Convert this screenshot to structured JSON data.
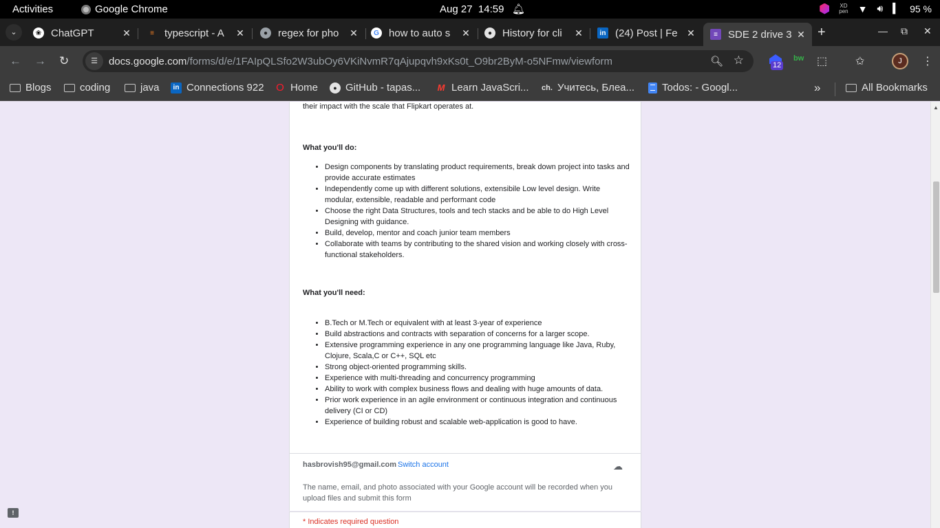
{
  "system_bar": {
    "activities": "Activities",
    "app_name": "Google Chrome",
    "date": "Aug 27",
    "time": "14:59",
    "battery": "95 %"
  },
  "tabs": [
    {
      "title": "ChatGPT",
      "icon": "chatgpt-icon"
    },
    {
      "title": "typescript - A",
      "icon": "stackoverflow-icon"
    },
    {
      "title": "regex for pho",
      "icon": "globe-icon"
    },
    {
      "title": "how to auto s",
      "icon": "google-icon"
    },
    {
      "title": "History for cli",
      "icon": "github-icon"
    },
    {
      "title": "(24) Post | Fe",
      "icon": "linkedin-icon"
    },
    {
      "title": "SDE 2 drive 3",
      "icon": "google-forms-icon",
      "active": true
    }
  ],
  "omnibox": {
    "host": "docs.google.com",
    "path": "/forms/d/e/1FAIpQLSfo2W3ubOy6VKiNvmR7qAjupqvh9xKs0t_O9br2ByM-o5NFmw/viewform"
  },
  "extensions": {
    "badge_count": "12",
    "bw_label": "bw",
    "profile_initial": "J"
  },
  "bookmarks": [
    {
      "label": "Blogs",
      "icon": "folder-icon"
    },
    {
      "label": "coding",
      "icon": "folder-icon"
    },
    {
      "label": "java",
      "icon": "folder-icon"
    },
    {
      "label": "Connections 922",
      "icon": "linkedin-icon"
    },
    {
      "label": "Home",
      "icon": "opera-icon"
    },
    {
      "label": "GitHub - tapas...",
      "icon": "github-icon"
    },
    {
      "label": "Learn JavaScri...",
      "icon": "m-icon"
    },
    {
      "label": "Учитесь, Блеа...",
      "icon": "ch-icon"
    },
    {
      "label": "Todos: - Googl...",
      "icon": "docs-icon"
    }
  ],
  "all_bookmarks": "All Bookmarks",
  "form": {
    "intro_tail": "their impact with the scale that Flipkart operates at.",
    "do_heading": "What you'll do:",
    "do_items": [
      "Design components by translating product requirements, break down project into tasks and provide accurate estimates",
      "Independently come up with different solutions, extensibile Low level design. Write modular, extensible, readable and performant code",
      "Choose the right Data Structures, tools  and tech stacks and be able to do High Level Designing with guidance.",
      "Build, develop, mentor and coach junior team members",
      "Collaborate with teams by contributing to the shared vision and working closely with cross-functional stakeholders."
    ],
    "need_heading": "What you'll need:",
    "need_items": [
      "B.Tech or M.Tech or equivalent with at least 3-year of experience",
      "Build abstractions and contracts with separation of concerns for a larger scope.",
      "Extensive programming experience in any one programming language like Java, Ruby, Clojure, Scala,C or C++, SQL etc",
      "Strong object-oriented programming skills.",
      "Experience with multi-threading and concurrency programming",
      "Ability to work with complex business flows and dealing with huge amounts of data.",
      "Prior work experience in an agile environment or continuous integration and continuous delivery (CI or CD)",
      "Experience of building robust and scalable web-application is good to have."
    ],
    "email": "hasbrovish95@gmail.com",
    "switch_account": "Switch account",
    "account_note": "The name, email, and photo associated with your Google account will be recorded when you upload files and submit this form",
    "required_note": "* Indicates required question"
  }
}
